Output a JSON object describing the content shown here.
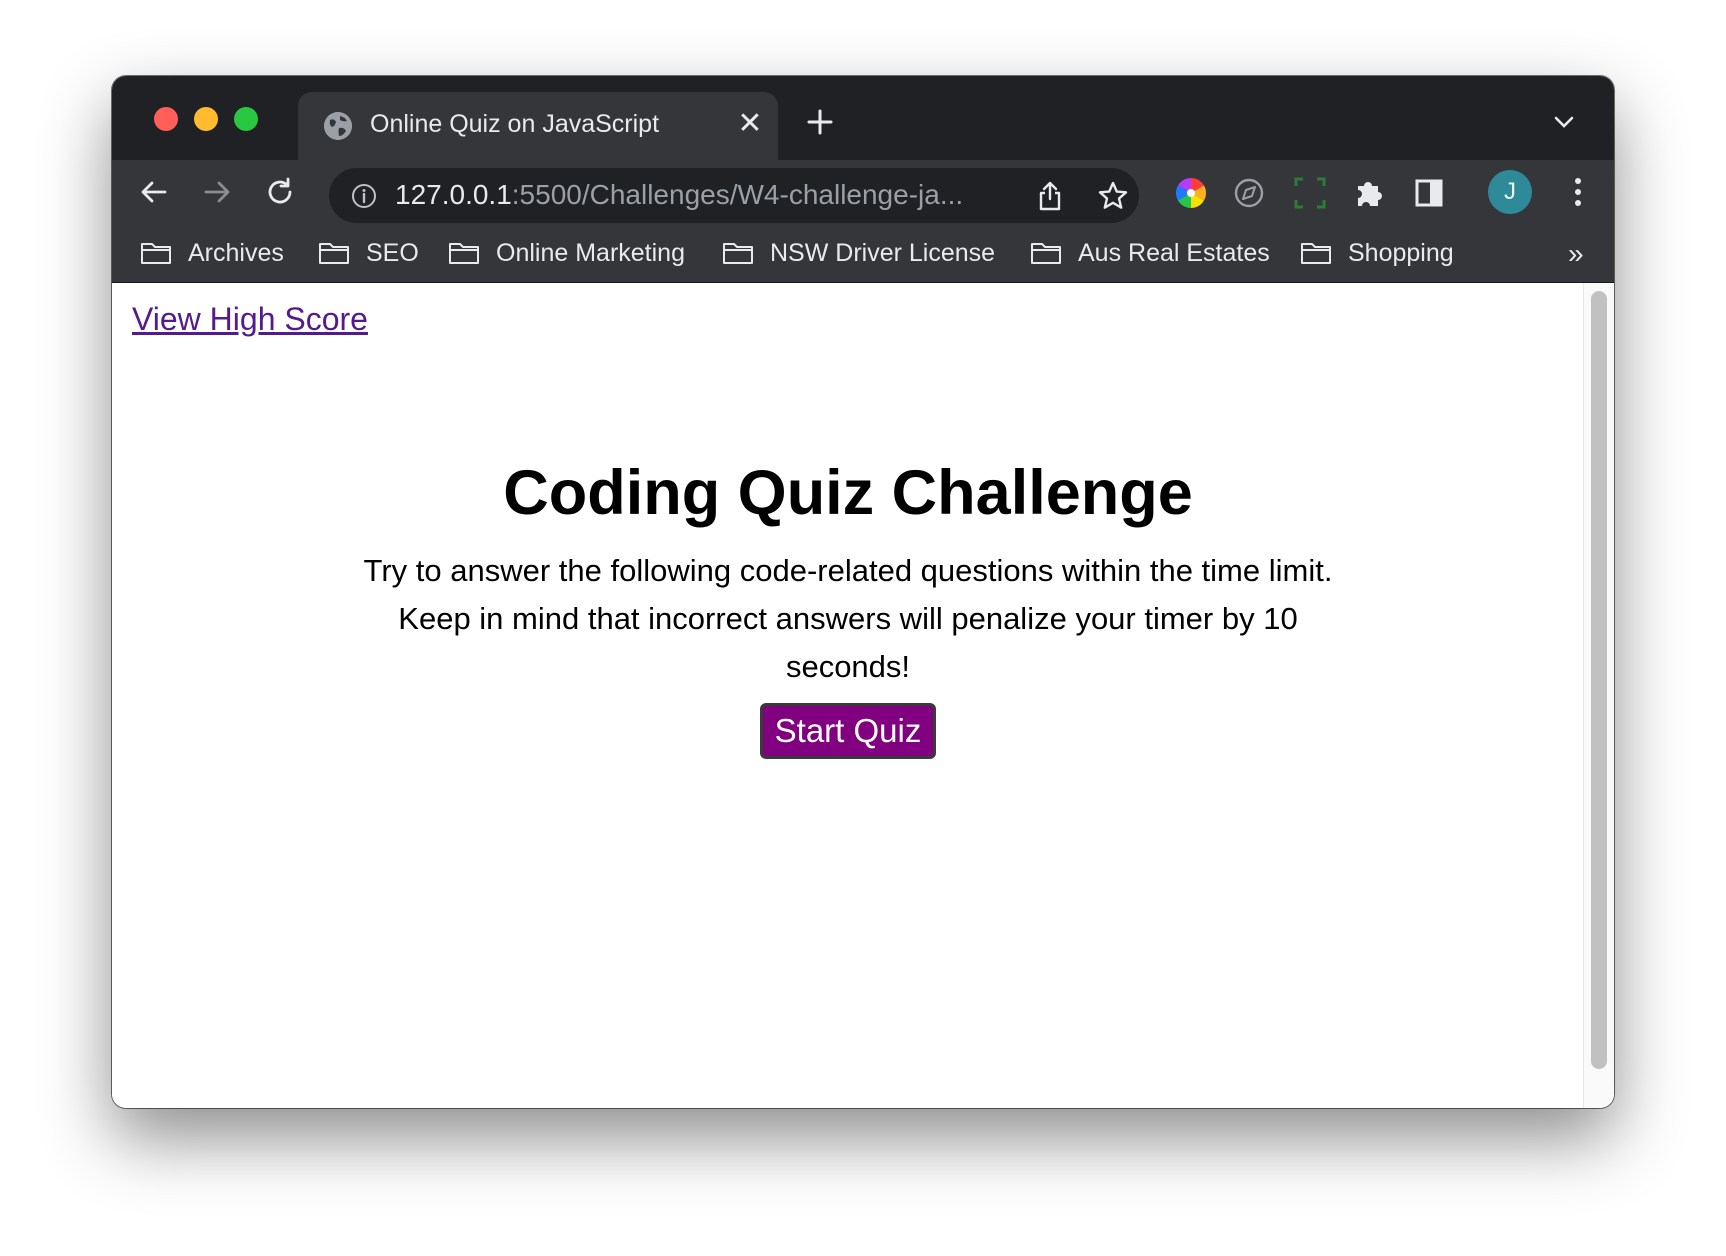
{
  "browser": {
    "tab": {
      "title": "Online Quiz on JavaScript"
    },
    "omnibox": {
      "url_host": "127.0.0.1",
      "url_path": ":5500/Challenges/W4-challenge-ja..."
    },
    "profile_initial": "J",
    "bookmarks": [
      {
        "label": "Archives"
      },
      {
        "label": "SEO"
      },
      {
        "label": "Online Marketing"
      },
      {
        "label": "NSW Driver License"
      },
      {
        "label": "Aus Real Estates"
      },
      {
        "label": "Shopping"
      }
    ],
    "bookmarks_overflow": "»"
  },
  "page": {
    "high_score_link": "View High Score",
    "title": "Coding Quiz Challenge",
    "description": "Try to answer the following code-related questions within the time limit. Keep in mind that incorrect answers will penalize your timer by 10 seconds!",
    "start_button": "Start Quiz"
  },
  "colors": {
    "tab_strip": "#202124",
    "toolbar": "#35363a",
    "link": "#551a8b",
    "start_button": "#800080",
    "avatar": "#2e8a99"
  },
  "icons": [
    "globe-icon",
    "close-icon",
    "plus-icon",
    "chevron-down-icon",
    "back-arrow-icon",
    "forward-arrow-icon",
    "reload-icon",
    "info-icon",
    "share-icon",
    "star-icon",
    "color-wheel-icon",
    "compass-icon",
    "screenshot-icon",
    "puzzle-icon",
    "sidebar-icon",
    "more-vert-icon",
    "folder-icon"
  ]
}
